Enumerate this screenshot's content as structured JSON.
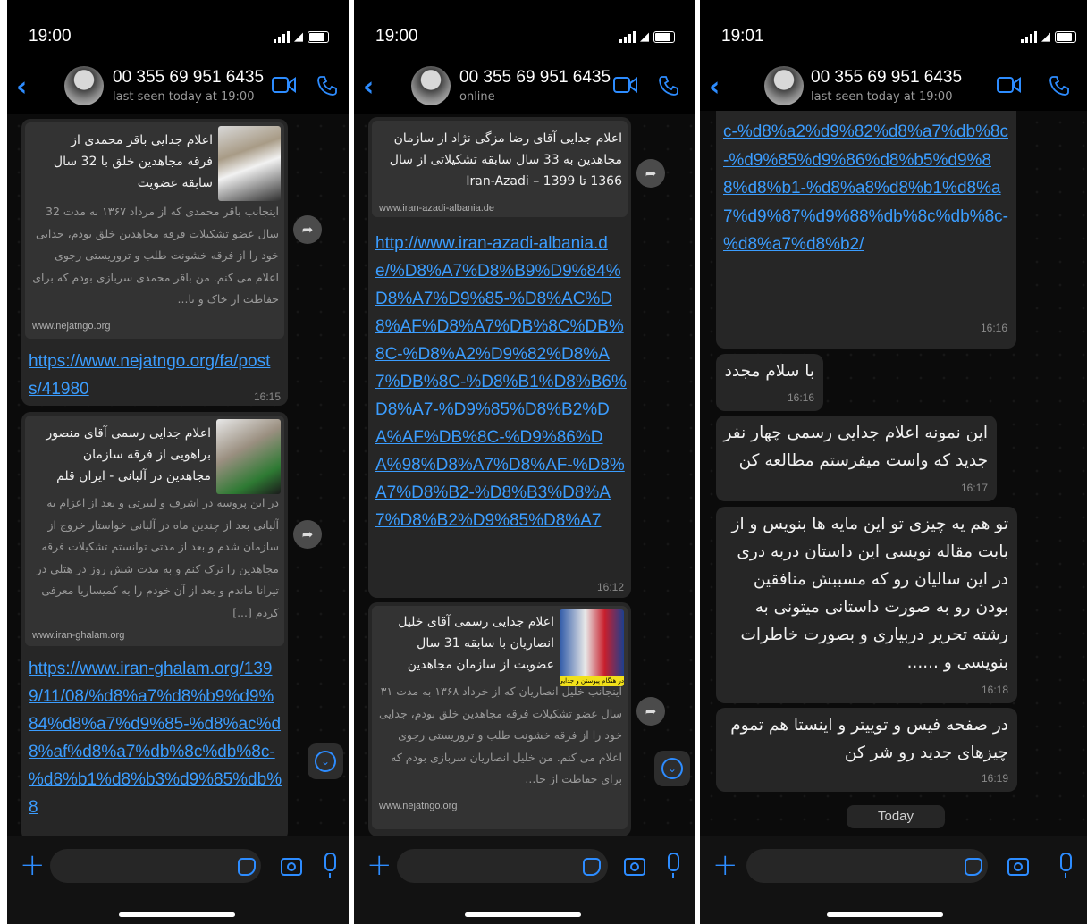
{
  "accent": "#2d8cff",
  "panels": [
    {
      "status_time": "19:00",
      "contact_name": "00 355 69 951 6435",
      "contact_status": "last seen today at 19:00",
      "messages": [
        {
          "preview_title": "اعلام جدایی باقر محمدی از فرقه مجاهدین خلق با 32 سال سابقه عضویت",
          "preview_desc": "اینجانب باقر محمدی که از مرداد ۱۳۶۷ به مدت 32 سال عضو تشکیلات فرقه مجاهدین خلق بودم، جدایی خود را از فرقه خشونت طلب و تروریستی رجوی اعلام می کنم. من باقر محمدی سربازی بودم که برای حفاظت از خاک و نا...",
          "preview_domain": "www.nejatngo.org",
          "link_text": "https://www.nejatngo.org/fa/posts/41980",
          "time": "16:15"
        },
        {
          "preview_title": "اعلام جدایی رسمی آقای منصور براهویی از فرقه سازمان مجاهدین در آلبانی - ایران قلم",
          "preview_desc": "در این پروسه در اشرف و لیبرتی و بعد از اعزام به آلبانی بعد از چندین ماه در آلبانی خواستار خروج از سازمان شدم و بعد از مدتی توانستم تشکیلات فرقه مجاهدین را ترک کنم و به مدت شش روز در هتلی در تیرانا ماندم و بعد از آن خودم را به کمیساریا معرفی کردم [...]",
          "preview_domain": "www.iran-ghalam.org",
          "link_text": "https://www.iran-ghalam.org/1399/11/08/%d8%a7%d8%b9%d9%84%d8%a7%d9%85-%d8%ac%d8%af%d8%a7%db%8c%db%8c-%d8%b1%d8%b3%d9%85%db%8"
        }
      ]
    },
    {
      "status_time": "19:00",
      "contact_name": "00 355 69 951 6435",
      "contact_status": "online",
      "messages": [
        {
          "preview_title": "اعلام جدایی آقای رضا مزگی نژاد از سازمان مجاهدین به 33 سال سابقه تشکیلاتی از سال 1366 تا 1399 – Iran-Azadi",
          "preview_domain": "www.iran-azadi-albania.de",
          "link_text": "http://www.iran-azadi-albania.de/%D8%A7%D8%B9%D9%84%D8%A7%D9%85-%D8%AC%D8%AF%D8%A7%DB%8C%DB%8C-%D8%A2%D9%82%D8%A7%DB%8C-%D8%B1%D8%B6%D8%A7-%D9%85%D8%B2%DA%AF%DB%8C-%D9%86%DA%98%D8%A7%D8%AF-%D8%A7%D8%B2-%D8%B3%D8%A7%D8%B2%D9%85%D8%A7",
          "time": "16:12"
        },
        {
          "preview_title": "اعلام جدایی رسمی آقای خلیل انصاریان با سابقه 31 سال عضویت از سازمان مجاهدین",
          "preview_desc": "اینجانب خلیل انصاریان که از خرداد ۱۳۶۸ به مدت ۳۱ سال عضو تشکیلات فرقه مجاهدین خلق بودم، جدایی خود را از فرقه خشونت طلب و تروریستی رجوی اعلام می کنم. من خلیل انصاریان سربازی بودم که برای حفاظت از خا...",
          "preview_domain": "www.nejatngo.org",
          "thumb_caption": "در هنگام پیوستن و جدایی از ساز"
        }
      ]
    },
    {
      "status_time": "19:01",
      "contact_name": "00 355 69 951 6435",
      "contact_status": "last seen today at 19:00",
      "link_fragment": "c-%d8%a2%d9%82%d8%a7%db%8c-%d9%85%d9%86%d8%b5%d9%88%d8%b1-%d8%a8%d8%b1%d8%a7%d9%87%d9%88%db%8c%db%8c-%d8%a7%d8%b2/",
      "link_time": "16:16",
      "messages": [
        {
          "text": "با سلام مجدد",
          "time": "16:16"
        },
        {
          "text": "این نمونه اعلام جدایی رسمی چهار نفر جدید که واست میفرستم مطالعه کن",
          "time": "16:17"
        },
        {
          "text": "تو هم یه چیزی تو این مایه ها بنویس و از بابت مقاله نویسی این داستان دربه دری در این سالیان رو که مسببش منافقین بودن رو به صورت داستانی میتونی به رشته تحریر دربیاری و بصورت خاطرات بنویسی و ......",
          "time": "16:18"
        },
        {
          "text": "در صفحه فیس و توییتر و اینستا هم تموم چیزهای جدید رو شر کن",
          "time": "16:19"
        }
      ],
      "date_label": "Today"
    }
  ],
  "icons": {
    "back": "chevron-left-icon",
    "video": "video-call-icon",
    "phone": "phone-icon",
    "attach": "plus-icon",
    "sticker": "sticker-icon",
    "camera": "camera-icon",
    "mic": "microphone-icon"
  }
}
